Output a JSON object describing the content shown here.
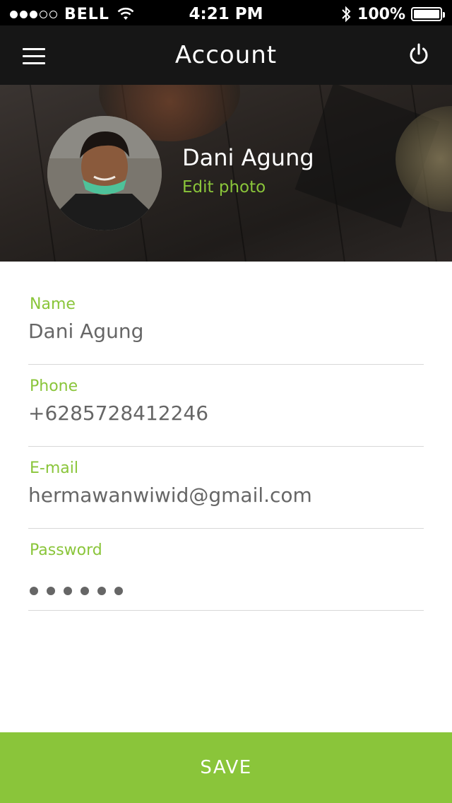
{
  "status_bar": {
    "carrier": "BELL",
    "signal_bars_filled": 3,
    "signal_bars_total": 5,
    "time": "4:21 PM",
    "battery_percent": "100%",
    "icons": [
      "wifi-icon",
      "bluetooth-icon",
      "battery-icon"
    ]
  },
  "header": {
    "title": "Account",
    "left_icon": "menu-icon",
    "right_icon": "power-icon"
  },
  "profile": {
    "name": "Dani Agung",
    "edit_photo_label": "Edit photo"
  },
  "form": {
    "name": {
      "label": "Name",
      "value": "Dani Agung"
    },
    "phone": {
      "label": "Phone",
      "value": "+6285728412246"
    },
    "email": {
      "label": "E-mail",
      "value": "hermawanwiwid@gmail.com"
    },
    "password": {
      "label": "Password",
      "masked_length": 6
    }
  },
  "save_label": "SAVE",
  "colors": {
    "accent": "#8ac53a",
    "header_bg": "#161616",
    "status_bar_bg": "#000000",
    "value_text": "#666666"
  }
}
